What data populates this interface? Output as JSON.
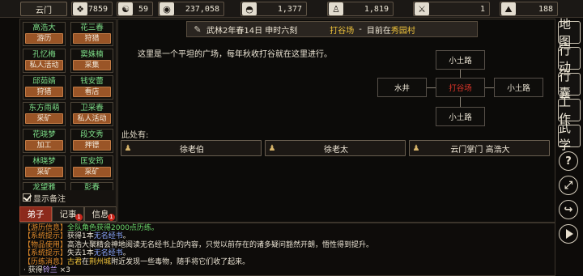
{
  "topbar": {
    "sect_name": "云门",
    "stats": [
      {
        "icon": "bag-icon",
        "glyph": "❖",
        "value": "7859"
      },
      {
        "icon": "yin-yang-icon",
        "glyph": "☯",
        "value": "59"
      },
      {
        "icon": "coin-icon",
        "glyph": "◉",
        "value": "237,058"
      },
      {
        "icon": "food-bowl-icon",
        "glyph": "◓",
        "value": "1,377"
      },
      {
        "icon": "meditate-icon",
        "glyph": "♙",
        "value": "1,819"
      },
      {
        "icon": "sword-icon",
        "glyph": "⚔",
        "value": "1"
      },
      {
        "icon": "mountain-icon",
        "glyph": "⛰",
        "value": "188"
      }
    ]
  },
  "npcs": [
    {
      "name": "高浩大",
      "action": "游历"
    },
    {
      "name": "花三春",
      "action": "狩猎"
    },
    {
      "name": "孔忆梅",
      "action": "私人活动"
    },
    {
      "name": "窦姝楠",
      "action": "采集"
    },
    {
      "name": "邱茹婧",
      "action": "狩猎"
    },
    {
      "name": "钱安蕾",
      "action": "看店"
    },
    {
      "name": "东方雨萌",
      "action": "采矿"
    },
    {
      "name": "卫采春",
      "action": "私人活动"
    },
    {
      "name": "花晓梦",
      "action": "加工"
    },
    {
      "name": "段文秀",
      "action": "押镖"
    },
    {
      "name": "林晓梦",
      "action": "采矿"
    },
    {
      "name": "匡安筠",
      "action": "采矿"
    },
    {
      "name": "龙望雅",
      "action": ""
    },
    {
      "name": "彭春",
      "action": ""
    }
  ],
  "remark_label": "显示备注",
  "tabs": [
    {
      "label": "弟子",
      "badge": ""
    },
    {
      "label": "记事",
      "badge": "1"
    },
    {
      "label": "信息",
      "badge": "1"
    }
  ],
  "location": {
    "date": "武林2年春14日 申时六刻",
    "place": "打谷场",
    "separator": "-",
    "currently_in": "目前在",
    "village": "秀园村"
  },
  "description": "这里是一个平坦的广场，每年秋收打谷就在这里进行。",
  "map": {
    "north": "小土路",
    "west": "水井",
    "center": "打谷场",
    "east": "小土路",
    "south": "小土路"
  },
  "here_label": "此处有:",
  "people_here": [
    "徐老伯",
    "徐老太",
    "云门掌门 高浩大"
  ],
  "log": [
    {
      "tag": "【游历信息】",
      "parts": [
        {
          "t": "全队角色获得2000点历练。",
          "c": "g"
        }
      ]
    },
    {
      "tag": "【系统提示】",
      "parts": [
        {
          "t": "获得1本",
          "c": ""
        },
        {
          "t": "无名经书",
          "c": "bl"
        },
        {
          "t": "。",
          "c": ""
        }
      ]
    },
    {
      "tag": "【物品使用】",
      "parts": [
        {
          "t": "高浩大聚精会神地阅读无名经书上的内容，只觉以前存在的诸多疑问豁然开朗，悟性得到提升。",
          "c": ""
        }
      ]
    },
    {
      "tag": "【系统提示】",
      "parts": [
        {
          "t": "失去1本",
          "c": ""
        },
        {
          "t": "无名经书",
          "c": "bl"
        },
        {
          "t": "。",
          "c": ""
        }
      ]
    },
    {
      "tag": "【历练消息】",
      "parts": [
        {
          "t": "古君",
          "c": "y"
        },
        {
          "t": "在",
          "c": ""
        },
        {
          "t": "荆州城",
          "c": "y"
        },
        {
          "t": "附近发现一些毒物，随手将它们收了起来。",
          "c": ""
        }
      ]
    },
    {
      "tag": "",
      "parts": [
        {
          "t": "   · 获得",
          "c": ""
        },
        {
          "t": "铃兰",
          "c": "pl"
        },
        {
          "t": " ×3",
          "c": ""
        }
      ]
    }
  ],
  "right_menu": [
    "地图",
    "行动",
    "行囊",
    "工作",
    "武学"
  ],
  "right_round": [
    {
      "icon": "help-icon",
      "glyph": "?"
    },
    {
      "icon": "expand-icon",
      "glyph": "⤢"
    },
    {
      "icon": "exit-icon",
      "glyph": "↪"
    }
  ],
  "play_icon": "play-icon"
}
